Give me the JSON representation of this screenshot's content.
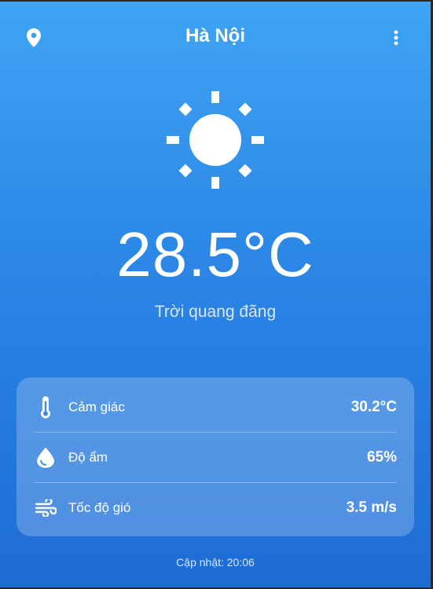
{
  "header": {
    "city": "Hà Nội",
    "location_icon": "location-pin-icon",
    "menu_icon": "more-vert-icon"
  },
  "current": {
    "condition_icon": "sun-icon",
    "temperature": "28.5°C",
    "description": "Trời quang đãng"
  },
  "details": [
    {
      "icon": "thermometer-icon",
      "label": "Cảm giác",
      "value": "30.2°C"
    },
    {
      "icon": "water-drop-icon",
      "label": "Độ ẩm",
      "value": "65%"
    },
    {
      "icon": "wind-icon",
      "label": "Tốc độ gió",
      "value": "3.5 m/s"
    }
  ],
  "footer": {
    "updated": "Cập nhật: 20:06"
  },
  "colors": {
    "gradient_top": "#3fa4f4",
    "gradient_bottom": "#1e6cd6",
    "text": "#ffffff"
  }
}
